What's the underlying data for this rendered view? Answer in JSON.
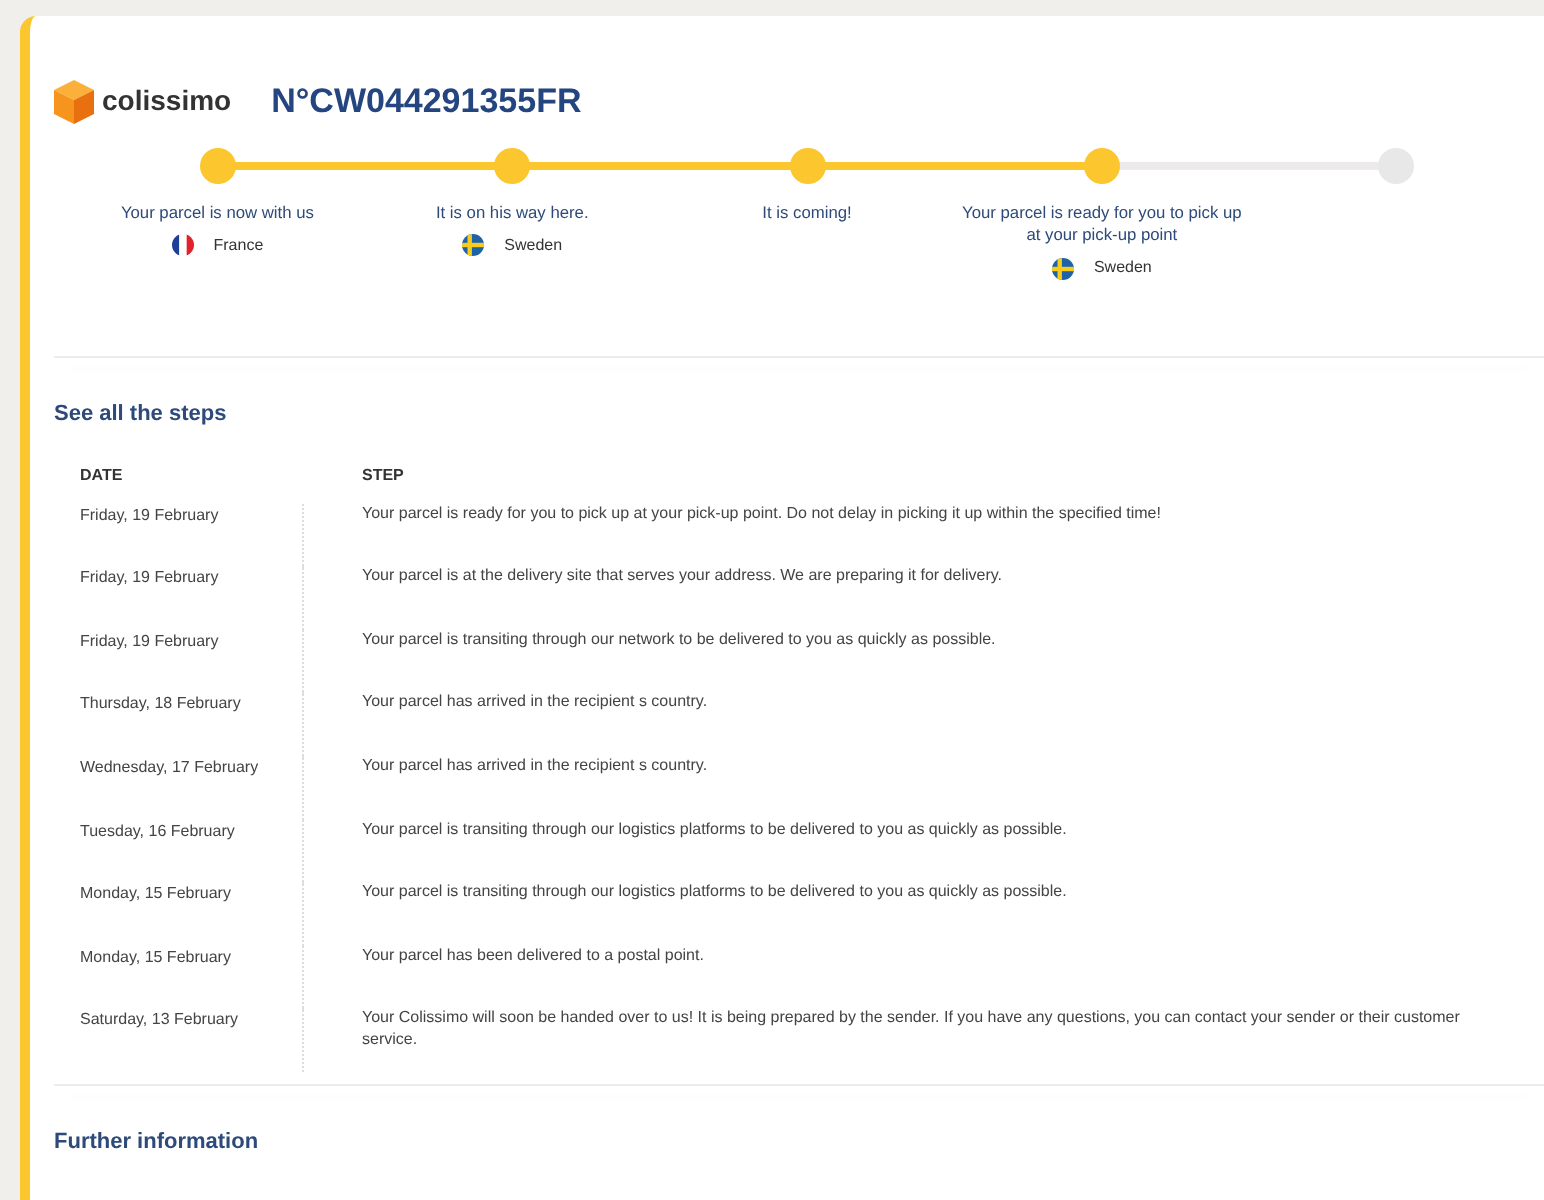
{
  "header": {
    "brand": "colissimo",
    "tracking_number": "N°CW044291355FR"
  },
  "progress": [
    {
      "label": "Your parcel is now with us",
      "country": "France",
      "kind": "france",
      "done": true
    },
    {
      "label": "It is on his way here.",
      "country": "Sweden",
      "kind": "sweden",
      "done": true
    },
    {
      "label": "It is coming!",
      "done": true
    },
    {
      "label": "Your parcel is ready for you to pick up at your pick-up point",
      "country": "Sweden",
      "kind": "sweden",
      "done": true
    },
    {
      "done": false
    }
  ],
  "steps_section": {
    "title": "See all the steps",
    "columns": [
      "DATE",
      "STEP"
    ],
    "rows": [
      {
        "date": "Friday, 19 February",
        "step": "Your parcel is ready for you to pick up at your pick-up point. Do not delay in picking it up within the specified time!"
      },
      {
        "date": "Friday, 19 February",
        "step": "Your parcel is at the delivery site that serves your address. We are preparing it for delivery."
      },
      {
        "date": "Friday, 19 February",
        "step": "Your parcel is transiting through our network to be delivered to you as quickly as possible."
      },
      {
        "date": "Thursday, 18 February",
        "step": "Your parcel has arrived in the recipient s country."
      },
      {
        "date": "Wednesday, 17 February",
        "step": "Your parcel has arrived in the recipient s country."
      },
      {
        "date": "Tuesday, 16 February",
        "step": "Your parcel is transiting through our logistics platforms to be delivered to you as quickly as possible."
      },
      {
        "date": "Monday, 15 February",
        "step": "Your parcel is transiting through our logistics platforms to be delivered to you as quickly as possible."
      },
      {
        "date": "Monday, 15 February",
        "step": "Your parcel has been delivered to a postal point."
      },
      {
        "date": "Saturday, 13 February",
        "step": "Your Colissimo will soon be handed over to us! It is being prepared by the sender. If you have any questions, you can contact your sender or their customer service."
      }
    ]
  },
  "further_section": {
    "title": "Further information"
  }
}
